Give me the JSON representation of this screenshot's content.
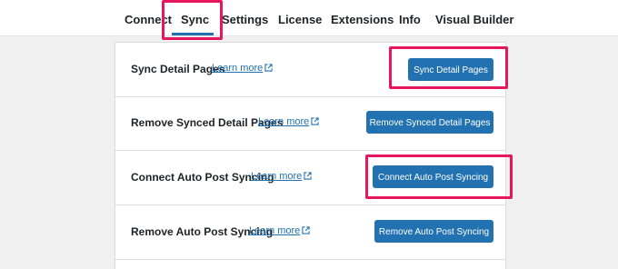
{
  "nav": {
    "tabs": [
      {
        "label": "Connect"
      },
      {
        "label": "Sync"
      },
      {
        "label": "Settings"
      },
      {
        "label": "License"
      },
      {
        "label": "Extensions"
      },
      {
        "label": "Info"
      },
      {
        "label": "Visual Builder"
      }
    ],
    "active": "Sync"
  },
  "rows": [
    {
      "label": "Sync Detail Pages",
      "link": "Learn more",
      "button": "Sync Detail Pages"
    },
    {
      "label": "Remove Synced Detail Pages",
      "link": "Learn more",
      "button": "Remove Synced Detail Pages"
    },
    {
      "label": "Connect Auto Post Syncing",
      "link": "Learn more",
      "button": "Connect Auto Post Syncing"
    },
    {
      "label": "Remove Auto Post Syncing",
      "link": "Learn more",
      "button": "Remove Auto Post Syncing"
    }
  ],
  "colors": {
    "highlight": "#e6175c",
    "button": "#2271b1",
    "link": "#2271b1"
  },
  "icons": {
    "external_link": "external-link-icon"
  }
}
